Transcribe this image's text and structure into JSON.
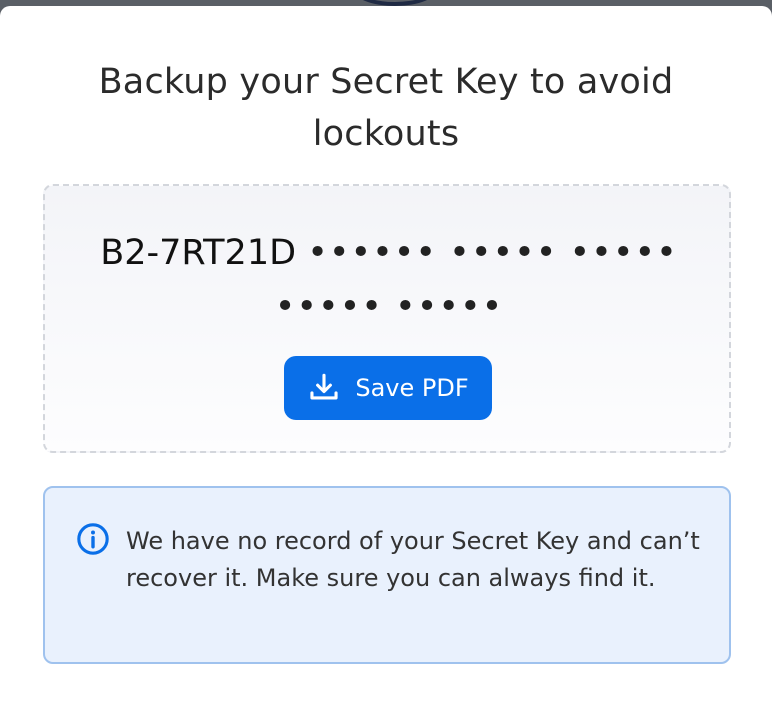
{
  "dialog": {
    "title": "Backup your Secret Key to avoid lockouts"
  },
  "secret_key": {
    "visible_part": "B2-7RT21D",
    "masked_part": "•••••• ••••• ••••• ••••• •••••"
  },
  "save_button": {
    "label": "Save PDF",
    "icon": "download-icon",
    "color": "#0a6fe8"
  },
  "notice": {
    "icon": "info-icon",
    "text": "We have no record of your Secret Key and can’t recover it. Make sure you can always find it.",
    "accent": "#0a6fe8"
  }
}
